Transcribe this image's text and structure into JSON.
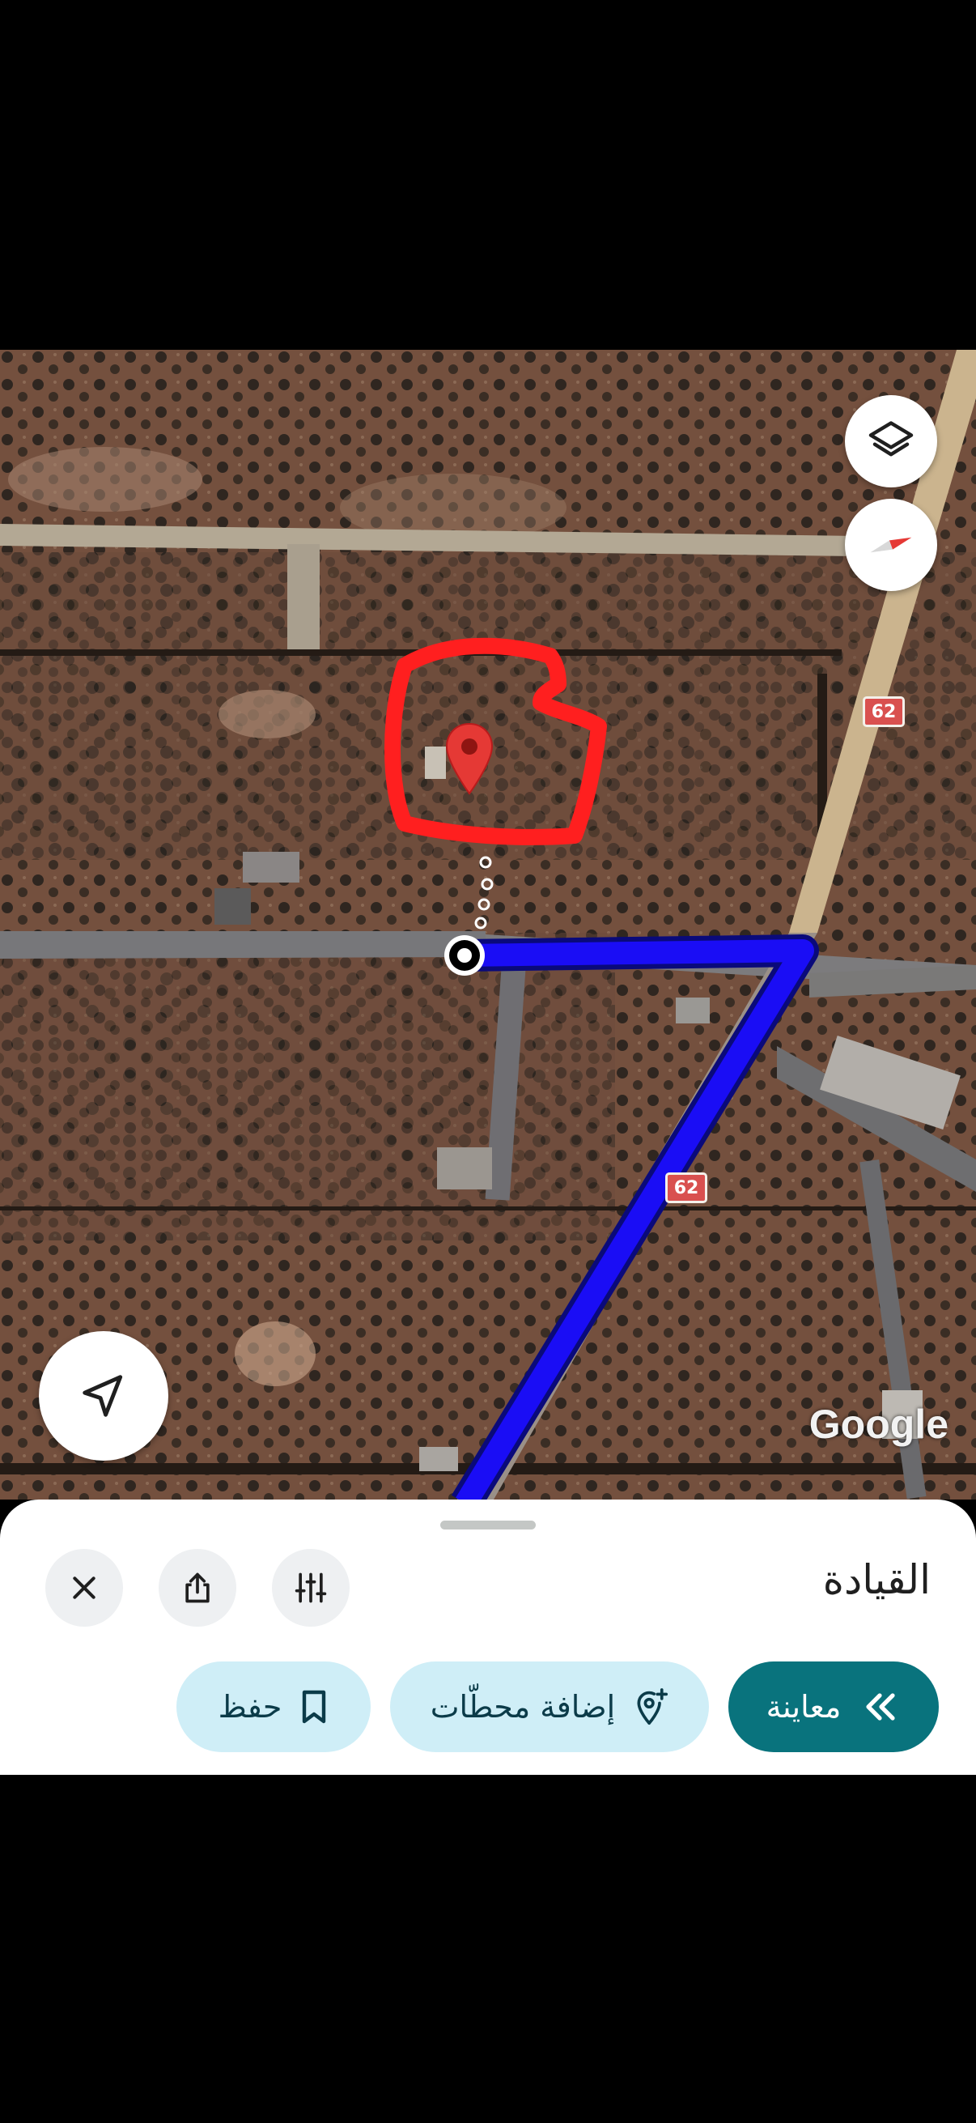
{
  "map": {
    "road_shield": "62",
    "attribution": "Google",
    "icons": [
      "layers-icon",
      "compass-icon",
      "location-arrow-icon",
      "place-marker-icon"
    ]
  },
  "sheet": {
    "title": "القيادة",
    "actions": {
      "close_icon": "close-icon",
      "share_icon": "share-icon",
      "options_icon": "route-options-icon"
    },
    "buttons": {
      "preview": "معاينة",
      "add_stops": "إضافة محطّات",
      "save": "حفظ"
    }
  },
  "colors": {
    "route": "#1a0df5",
    "annotation": "#ff1f1f",
    "marker": "#e53935",
    "preview_button": "#09737d",
    "secondary_button": "#cfeef7"
  }
}
